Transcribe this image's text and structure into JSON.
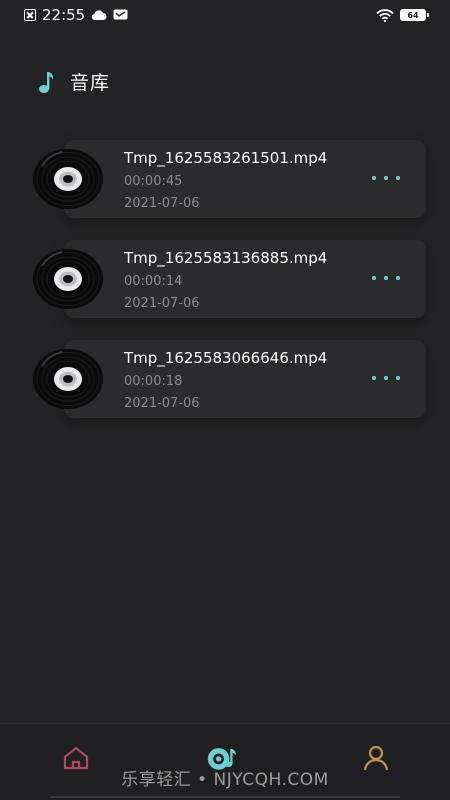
{
  "status_bar": {
    "time": "22:55",
    "battery": "64"
  },
  "header": {
    "icon": "music-note-icon",
    "title": "音库"
  },
  "tracks": [
    {
      "name": "Tmp_1625583261501.mp4",
      "duration": "00:00:45",
      "date": "2021-07-06"
    },
    {
      "name": "Tmp_1625583136885.mp4",
      "duration": "00:00:14",
      "date": "2021-07-06"
    },
    {
      "name": "Tmp_1625583066646.mp4",
      "duration": "00:00:18",
      "date": "2021-07-06"
    }
  ],
  "nav": {
    "items": [
      {
        "icon": "home-icon",
        "active": false
      },
      {
        "icon": "music-library-icon",
        "active": true
      },
      {
        "icon": "profile-icon",
        "active": false
      }
    ]
  },
  "watermark": "乐享轻汇 • NJYCQH.COM",
  "colors": {
    "background": "#232325",
    "card": "#2b2b2e",
    "accent": "#6ad1cf",
    "secondary_text": "#8d8d90",
    "home_icon": "#b0485f",
    "profile_icon": "#c8914a"
  }
}
